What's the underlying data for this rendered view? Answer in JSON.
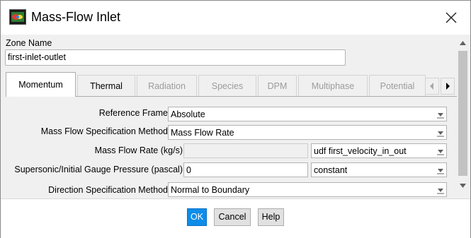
{
  "window": {
    "title": "Mass-Flow Inlet",
    "icon": "fluent-app-icon",
    "close_icon": "close-icon"
  },
  "zone": {
    "label": "Zone Name",
    "value": "first-inlet-outlet"
  },
  "tabs": [
    {
      "label": "Momentum",
      "state": "active"
    },
    {
      "label": "Thermal",
      "state": "enabled"
    },
    {
      "label": "Radiation",
      "state": "disabled"
    },
    {
      "label": "Species",
      "state": "disabled"
    },
    {
      "label": "DPM",
      "state": "disabled"
    },
    {
      "label": "Multiphase",
      "state": "disabled"
    },
    {
      "label": "Potential",
      "state": "disabled"
    }
  ],
  "momentum": {
    "reference_frame": {
      "label": "Reference Frame",
      "value": "Absolute"
    },
    "mass_flow_spec_method": {
      "label": "Mass Flow Specification Method",
      "value": "Mass Flow Rate"
    },
    "mass_flow_rate": {
      "label": "Mass Flow Rate (kg/s)",
      "value": "",
      "profile": "udf first_velocity_in_out"
    },
    "gauge_pressure": {
      "label": "Supersonic/Initial Gauge Pressure (pascal)",
      "value": "0",
      "profile": "constant"
    },
    "direction_spec_method": {
      "label": "Direction Specification Method",
      "value": "Normal to Boundary"
    }
  },
  "buttons": {
    "ok": "OK",
    "cancel": "Cancel",
    "help": "Help"
  },
  "colors": {
    "ok_button": "#0e8de8",
    "panel_background": "#f0f0f0",
    "disabled_text": "#9b9b9b"
  }
}
